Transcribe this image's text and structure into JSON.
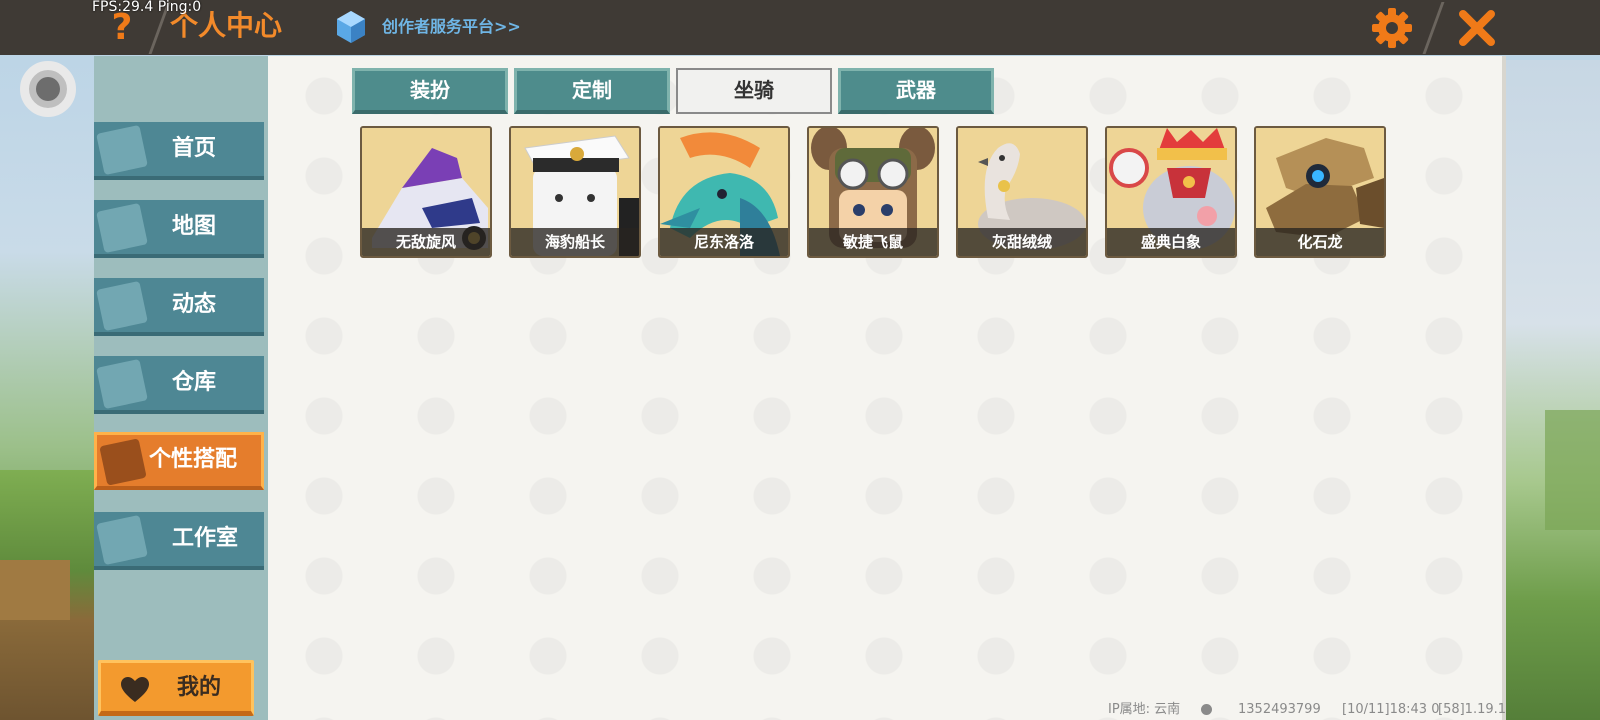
{
  "status": {
    "fps_text": "FPS:29.4",
    "ping_text": "Ping:0"
  },
  "header": {
    "help_glyph": "?",
    "title": "个人中心",
    "creator_link": "创作者服务平台>>"
  },
  "sidebar": {
    "items": [
      {
        "label": "首页",
        "icon": "home-icon"
      },
      {
        "label": "地图",
        "icon": "map-icon"
      },
      {
        "label": "动态",
        "icon": "bell-icon"
      },
      {
        "label": "仓库",
        "icon": "warehouse-icon"
      },
      {
        "label": "个性搭配",
        "icon": "outfit-icon",
        "active": true
      },
      {
        "label": "工作室",
        "icon": "studio-icon"
      }
    ],
    "mine_label": "我的"
  },
  "tabs": [
    {
      "label": "装扮"
    },
    {
      "label": "定制"
    },
    {
      "label": "坐骑",
      "active": true
    },
    {
      "label": "武器"
    }
  ],
  "mounts": [
    {
      "name": "无敌旋风"
    },
    {
      "name": "海豹船长"
    },
    {
      "name": "尼东洛洛"
    },
    {
      "name": "敏捷飞鼠"
    },
    {
      "name": "灰甜绒绒"
    },
    {
      "name": "盛典白象"
    },
    {
      "name": "化石龙"
    }
  ],
  "footer": {
    "ip_location": "IP属地: 云南",
    "user_id": "1352493799",
    "time_info": "[10/11]18:43 0",
    "version": "[58]1.19.1"
  },
  "colors": {
    "accent_orange": "#f07a18",
    "teal": "#4e8c8c",
    "topbar": "#3f3a35"
  }
}
